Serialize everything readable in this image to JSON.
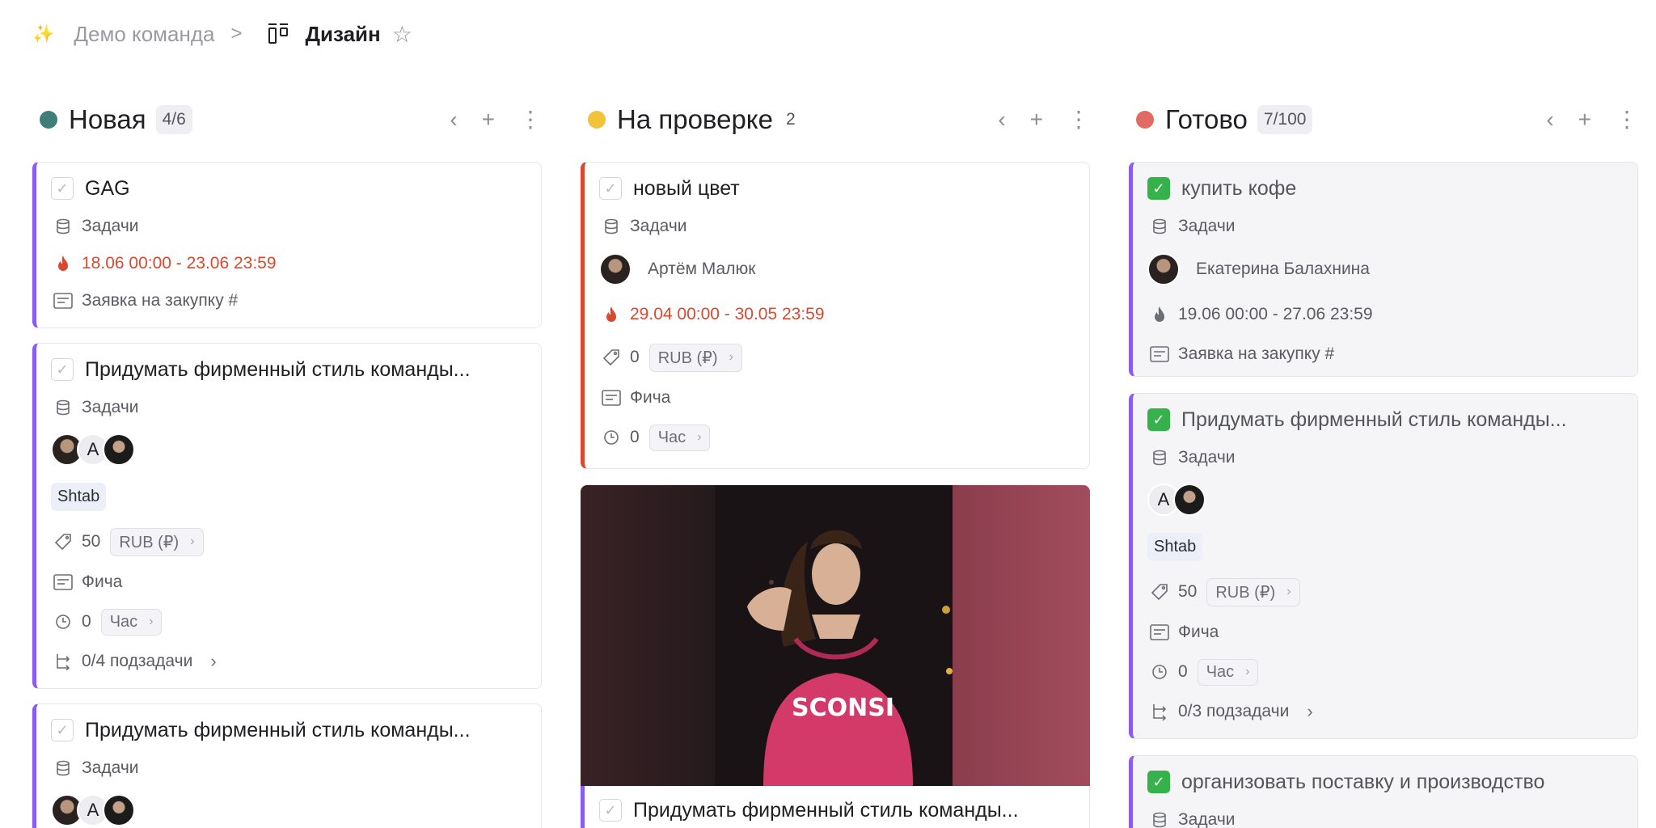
{
  "breadcrumb": {
    "parent": "Демо команда",
    "separator": ">",
    "current": "Дизайн"
  },
  "icons": {
    "sparkle": "sparkle-icon",
    "board": "kanban-board-icon",
    "star": "star-icon",
    "database": "database-icon",
    "flame": "flame-icon",
    "form": "form-icon",
    "price_tag": "price-tag-icon",
    "clock": "clock-icon",
    "subtasks": "subtasks-icon"
  },
  "colors": {
    "accent_purple": "#8a5cf6",
    "accent_red": "#d9492f",
    "status_new": "#3e7f78",
    "status_review": "#f2c23a",
    "status_done": "#e36a62",
    "check_green": "#35b24b"
  },
  "columns": [
    {
      "title": "Новая",
      "count": "4/6",
      "cards": [
        {
          "title": "GAG",
          "database": "Задачи",
          "date": "18.06 00:00 - 23.06 23:59",
          "form": "Заявка на закупку #"
        },
        {
          "title": "Придумать фирменный стиль команды...",
          "database": "Задачи",
          "avatar_letter": "A",
          "tag": "Shtab",
          "price": "50",
          "currency": "RUB (₽)",
          "form": "Фича",
          "hours": "0",
          "hours_unit": "Час",
          "subtasks": "0/4 подзадачи"
        },
        {
          "title": "Придумать фирменный стиль команды...",
          "database": "Задачи",
          "avatar_letter": "A"
        }
      ]
    },
    {
      "title": "На проверке",
      "count": "2",
      "cards": [
        {
          "title": "новый цвет",
          "database": "Задачи",
          "person": "Артём Малюк",
          "date": "29.04 00:00 - 30.05 23:59",
          "price": "0",
          "currency": "RUB (₽)",
          "form": "Фича",
          "hours": "0",
          "hours_unit": "Час"
        },
        {
          "title": "Придумать фирменный стиль команды..."
        }
      ]
    },
    {
      "title": "Готово",
      "count": "7/100",
      "cards": [
        {
          "title": "купить кофе",
          "database": "Задачи",
          "person": "Екатерина Балахнина",
          "date": "19.06 00:00 - 27.06 23:59",
          "form": "Заявка на закупку #"
        },
        {
          "title": "Придумать фирменный стиль команды...",
          "database": "Задачи",
          "avatar_letter": "A",
          "tag": "Shtab",
          "price": "50",
          "currency": "RUB (₽)",
          "form": "Фича",
          "hours": "0",
          "hours_unit": "Час",
          "subtasks": "0/3 подзадачи"
        },
        {
          "title": "организовать поставку и производство",
          "database": "Задачи"
        }
      ]
    }
  ]
}
